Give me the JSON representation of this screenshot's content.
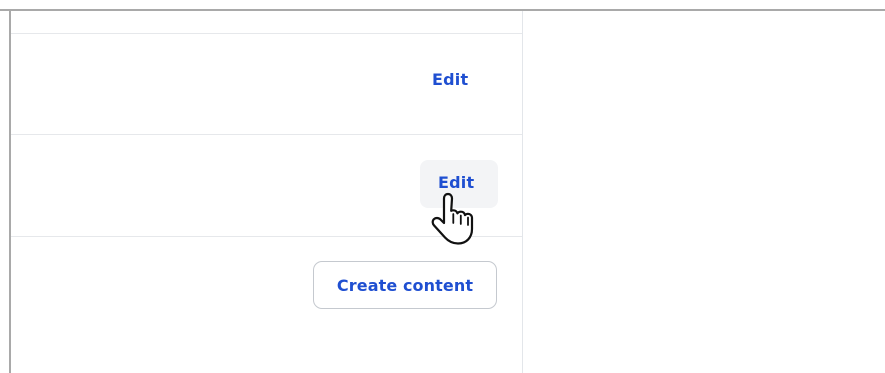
{
  "rows": [
    {
      "action_label": "Edit"
    },
    {
      "action_label": "Edit",
      "hovered": true
    },
    {
      "action_label": "Create content"
    }
  ],
  "icons": {
    "cursor": "hand-pointer-icon"
  },
  "colors": {
    "link": "#1f4fd1",
    "hover_background": "#f3f4f6",
    "divider": "#e6e8eb",
    "frame_border": "#a9a9a9"
  }
}
